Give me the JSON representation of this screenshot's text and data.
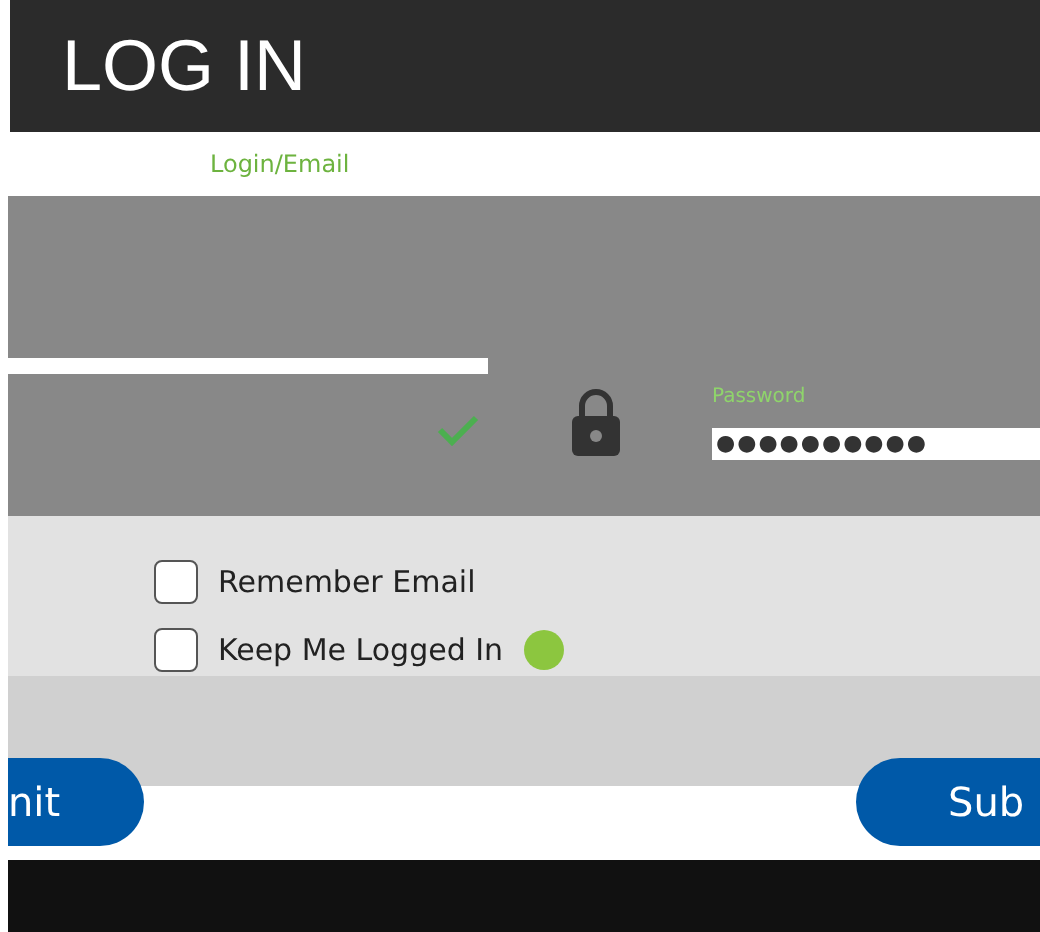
{
  "header": {
    "title": "LOG IN"
  },
  "login": {
    "label": "Login/Email",
    "valid": true
  },
  "password": {
    "label": "Password",
    "value": "●●●●●●●●●●"
  },
  "options": [
    {
      "label": "Remember Email",
      "checked": false,
      "help": false
    },
    {
      "label": "Keep Me Logged In",
      "checked": false,
      "help": true
    }
  ],
  "buttons": [
    {
      "label": "nit"
    },
    {
      "label": "Sub"
    }
  ]
}
